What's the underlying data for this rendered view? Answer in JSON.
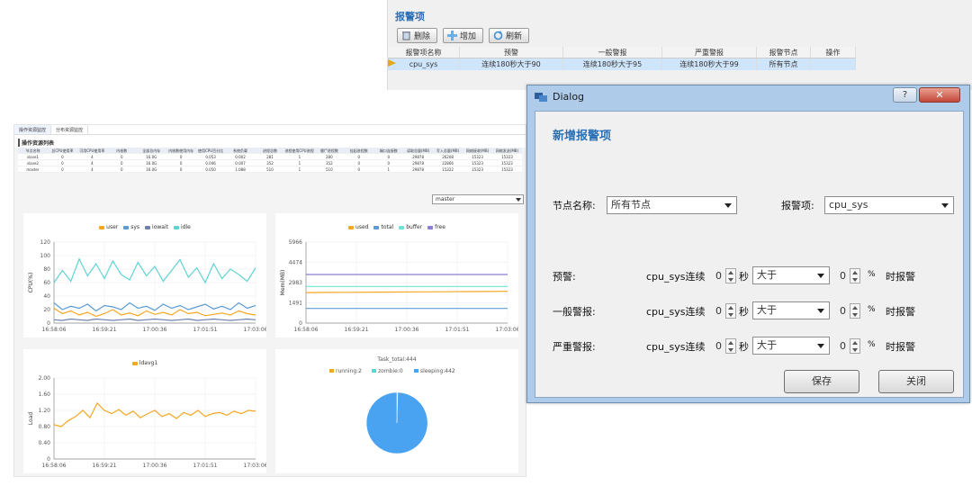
{
  "alert_window": {
    "title": "报警项",
    "toolbar": [
      {
        "label": "删除",
        "icon": "trash-icon"
      },
      {
        "label": "增加",
        "icon": "plus-icon"
      },
      {
        "label": "刷新",
        "icon": "refresh-icon"
      }
    ],
    "columns": [
      "报警项名称",
      "预警",
      "一般警报",
      "严重警报",
      "报警节点",
      "操作"
    ],
    "rows": [
      {
        "name": "cpu_sys",
        "warn": "连续180秒大于90",
        "general": "连续180秒大于95",
        "severe": "连续180秒大于99",
        "node": "所有节点",
        "op": ""
      }
    ]
  },
  "dashboard": {
    "tabs": [
      "操作资源监控",
      "分布资源监控"
    ],
    "title": "操作资源列表",
    "host_table": {
      "columns": [
        "节点名称",
        "总CPU使用率",
        "可用CPU使用率",
        "内核数",
        "全部总内存",
        "内核数使用内存",
        "使用CPU百分比",
        "系统负载",
        "进程总数",
        "进程使用CPU进程数",
        "僵尸进程数",
        "挂起进程数",
        "端口连接数",
        "读取总量(MB)",
        "写入总量(MB)",
        "网络接收(MB)",
        "网络发送(MB)"
      ],
      "rows": [
        [
          "slave1",
          "0",
          "4",
          "0",
          "16.0G",
          "0",
          "0.053",
          "0.002",
          "281",
          "1",
          "280",
          "0",
          "0",
          "29878",
          "26208",
          "15323",
          "15323"
        ],
        [
          "slave2",
          "0",
          "4",
          "0",
          "16.0G",
          "0",
          "0.046",
          "0.007",
          "352",
          "1",
          "352",
          "0",
          "0",
          "29878",
          "22866",
          "15323",
          "15323"
        ],
        [
          "master",
          "0",
          "4",
          "0",
          "16.0G",
          "0",
          "0.050",
          "1.088",
          "510",
          "1",
          "510",
          "0",
          "1",
          "29878",
          "15322",
          "15323",
          "15323"
        ]
      ]
    },
    "host_select": "master",
    "cpu_chart": {
      "legend": [
        "user",
        "sys",
        "iowait",
        "idle"
      ],
      "colors": [
        "#f5a623",
        "#5b9bd5",
        "#6f7fae",
        "#5fd3d3"
      ],
      "y_ticks": [
        "120",
        "100",
        "80",
        "60",
        "40",
        "20",
        "0"
      ],
      "y_label": "CPU(%)",
      "x_ticks": [
        "16:58:06",
        "16:59:21",
        "17:00:36",
        "17:01:51",
        "17:03:06"
      ]
    },
    "mem_chart": {
      "legend": [
        "used",
        "total",
        "buffer",
        "free"
      ],
      "colors": [
        "#f5a623",
        "#5b9bd5",
        "#6fe3d7",
        "#8b7fd6"
      ],
      "y_ticks": [
        "5966",
        "4474",
        "2983",
        "1491",
        "0"
      ],
      "y_label": "Mem(MB)",
      "x_ticks": [
        "16:58:06",
        "16:59:21",
        "17:00:36",
        "17:01:51",
        "17:03:06"
      ]
    },
    "load_chart": {
      "legend": [
        "ldavg1"
      ],
      "colors": [
        "#f5a623"
      ],
      "y_ticks": [
        "2.00",
        "1.60",
        "1.20",
        "0.80",
        "0.40",
        "0"
      ],
      "y_label": "Load",
      "x_ticks": [
        "16:58:06",
        "16:59:21",
        "17:00:36",
        "17:01:51",
        "17:03:06"
      ]
    },
    "task_chart": {
      "title": "Task_total:444",
      "legend": [
        "running:2",
        "zombie:0",
        "sleeping:442"
      ],
      "colors": [
        "#f5a623",
        "#5fd3d3",
        "#4aa3f0"
      ]
    }
  },
  "dialog": {
    "title": "Dialog",
    "help": "?",
    "close": "✕",
    "heading": "新增报警项",
    "node_label": "节点名称:",
    "node_value": "所有节点",
    "item_label": "报警项:",
    "item_value": "cpu_sys",
    "levels": [
      {
        "label": "预警:",
        "metric": "cpu_sys连续",
        "seconds": "0",
        "sec_unit": "秒",
        "op": "大于",
        "value": "0",
        "pct": "%",
        "suffix": "时报警"
      },
      {
        "label": "一般警报:",
        "metric": "cpu_sys连续",
        "seconds": "0",
        "sec_unit": "秒",
        "op": "大于",
        "value": "0",
        "pct": "%",
        "suffix": "时报警"
      },
      {
        "label": "严重警报:",
        "metric": "cpu_sys连续",
        "seconds": "0",
        "sec_unit": "秒",
        "op": "大于",
        "value": "0",
        "pct": "%",
        "suffix": "时报警"
      }
    ],
    "save": "保存",
    "close_btn": "关闭"
  },
  "chart_data": [
    {
      "type": "line",
      "x": [
        "16:58:06",
        "16:59:21",
        "17:00:36",
        "17:01:51",
        "17:03:06"
      ],
      "ylabel": "CPU(%)",
      "ylim": [
        0,
        120
      ],
      "legend_position": "top",
      "series": [
        {
          "name": "user",
          "values": [
            22,
            14,
            18,
            12,
            16,
            10,
            14,
            20,
            12,
            15,
            11,
            18,
            13,
            16,
            12,
            20,
            14,
            16,
            11,
            13,
            15,
            12,
            18,
            14,
            12
          ]
        },
        {
          "name": "sys",
          "values": [
            30,
            20,
            25,
            22,
            28,
            18,
            26,
            24,
            20,
            30,
            22,
            25,
            19,
            28,
            22,
            26,
            20,
            24,
            28,
            21,
            25,
            20,
            30,
            22,
            26
          ]
        },
        {
          "name": "iowait",
          "values": [
            5,
            4,
            6,
            5,
            4,
            6,
            5,
            4,
            5,
            6,
            4,
            5,
            6,
            5,
            4,
            5,
            6,
            4,
            5,
            6,
            5,
            4,
            5,
            6,
            5
          ]
        },
        {
          "name": "idle",
          "values": [
            60,
            78,
            62,
            95,
            70,
            88,
            66,
            92,
            72,
            64,
            90,
            70,
            84,
            62,
            78,
            94,
            68,
            82,
            60,
            88,
            66,
            80,
            72,
            62,
            82
          ]
        }
      ]
    },
    {
      "type": "line",
      "x": [
        "16:58:06",
        "16:59:21",
        "17:00:36",
        "17:01:51",
        "17:03:06"
      ],
      "ylabel": "Mem(MB)",
      "ylim": [
        0,
        5966
      ],
      "legend_position": "top",
      "series": [
        {
          "name": "used",
          "values": [
            2250,
            2260,
            2270,
            2280,
            2290,
            2300,
            2310,
            2320,
            2330,
            2340
          ]
        },
        {
          "name": "total",
          "values": [
            1080,
            1080,
            1080,
            1080,
            1080,
            1080,
            1080,
            1080,
            1080,
            1080
          ]
        },
        {
          "name": "buffer",
          "values": [
            2700,
            2700,
            2700,
            2700,
            2700,
            2700,
            2700,
            2700,
            2700,
            2700
          ]
        },
        {
          "name": "free",
          "values": [
            3580,
            3580,
            3580,
            3580,
            3580,
            3580,
            3580,
            3580,
            3580,
            3580
          ]
        }
      ]
    },
    {
      "type": "line",
      "x": [
        "16:58:06",
        "16:59:21",
        "17:00:36",
        "17:01:51",
        "17:03:06"
      ],
      "ylabel": "Load",
      "ylim": [
        0,
        2.0
      ],
      "legend_position": "top",
      "series": [
        {
          "name": "ldavg1",
          "values": [
            0.85,
            0.8,
            0.95,
            1.05,
            1.2,
            1.02,
            1.38,
            1.2,
            1.12,
            1.22,
            1.08,
            1.18,
            1.02,
            1.12,
            1.2,
            1.05,
            1.12,
            1.0,
            1.15,
            1.08,
            1.2,
            1.05,
            1.12,
            1.15,
            1.08,
            1.18,
            1.12,
            1.2,
            1.18
          ]
        }
      ]
    },
    {
      "type": "pie",
      "title": "Task_total:444",
      "legend_position": "top",
      "categories": [
        "running",
        "zombie",
        "sleeping"
      ],
      "values": [
        2,
        0,
        442
      ]
    }
  ]
}
